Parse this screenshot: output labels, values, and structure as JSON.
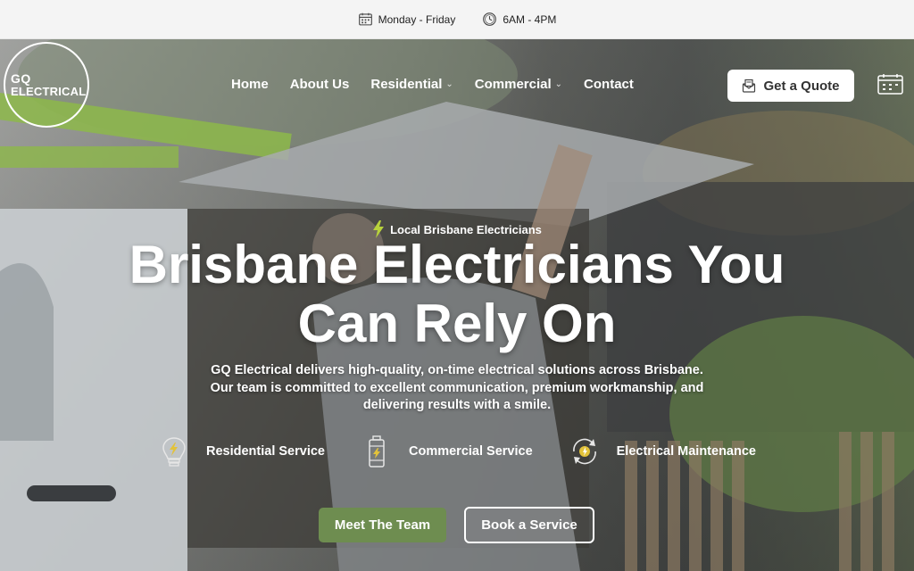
{
  "topbar": {
    "days": "Monday - Friday",
    "hours": "6AM - 4PM",
    "calendar_icon": "calendar-icon",
    "clock_icon": "clock-icon"
  },
  "logo": {
    "line1": "GQ",
    "line2": "ELECTRICAL"
  },
  "nav": {
    "items": [
      {
        "label": "Home"
      },
      {
        "label": "About Us"
      },
      {
        "label": "Residential",
        "dropdown": true
      },
      {
        "label": "Commercial",
        "dropdown": true
      },
      {
        "label": "Contact"
      }
    ],
    "quote_label": "Get a Quote",
    "quote_icon": "quote-envelope-icon",
    "booking_icon": "booking-calendar-icon"
  },
  "hero": {
    "badge": "Local Brisbane Electricians",
    "badge_icon": "lightning-icon",
    "headline_line1": "Brisbane Electricians You",
    "headline_line2": "Can Rely On",
    "subtext": "GQ Electrical delivers high-quality, on-time electrical solutions across Brisbane. Our team is committed to excellent communication, premium workmanship, and delivering results with a smile.",
    "services": [
      {
        "label": "Residential Service",
        "icon": "lightbulb-icon"
      },
      {
        "label": "Commercial Service",
        "icon": "battery-icon"
      },
      {
        "label": "Electrical Maintenance",
        "icon": "maintenance-cycle-icon"
      }
    ],
    "primary_cta": "Meet The Team",
    "secondary_cta": "Book a Service"
  },
  "colors": {
    "accent": "#6e8d50",
    "topbar_bg": "#f4f4f4",
    "icon_yellow": "#e2c23a"
  }
}
